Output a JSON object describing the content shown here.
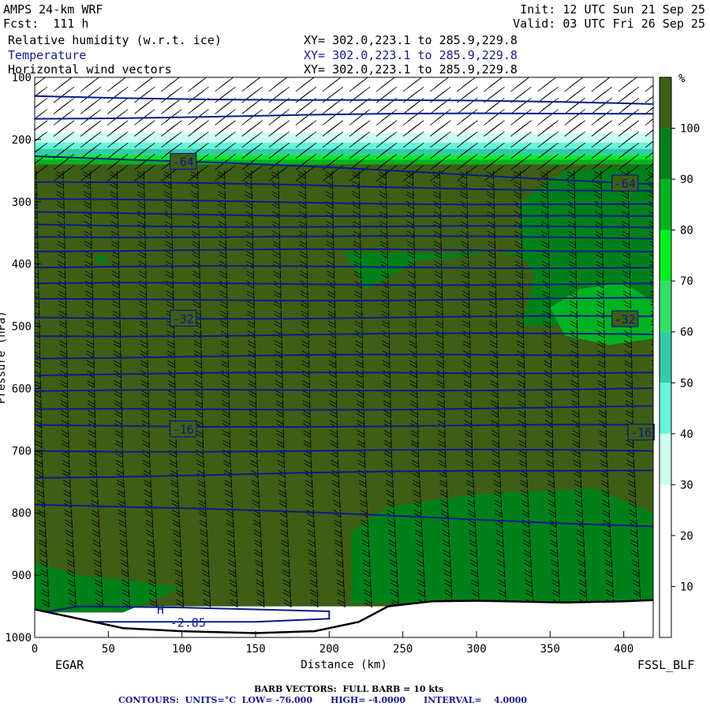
{
  "header": {
    "model": "AMPS 24-km WRF",
    "fcst": "Fcst:  111 h",
    "init": "Init: 12 UTC Sun 21 Sep 25",
    "valid": "Valid: 03 UTC Fri 26 Sep 25",
    "fields": [
      {
        "name": "Relative humidity (w.r.t. ice)",
        "xy": "XY= 302.0,223.1 to 285.9,229.8",
        "color": "#000000"
      },
      {
        "name": "Temperature",
        "xy": "XY= 302.0,223.1 to 285.9,229.8",
        "color": "#1a1a8c"
      },
      {
        "name": "Horizontal wind vectors",
        "xy": "XY= 302.0,223.1 to 285.9,229.8",
        "color": "#000000"
      }
    ]
  },
  "footer": {
    "left_label": "EGAR",
    "right_label": "FSSL_BLF",
    "barb_note": "BARB VECTORS:  FULL BARB = 10 kts",
    "contours": "CONTOURS:  UNITS=°C  LOW= -76.000      HIGH= -4.0000      INTERVAL=    4.0000"
  },
  "chart_data": {
    "type": "heatmap",
    "title": "Relative humidity (w.r.t. ice) / Temperature / Horizontal wind vectors",
    "xlabel": "Distance (km)",
    "ylabel": "Pressure (hPa)",
    "xlim": [
      0,
      420
    ],
    "ylim": [
      1000,
      100
    ],
    "xticks": [
      0,
      50,
      100,
      150,
      200,
      250,
      300,
      350,
      400
    ],
    "yticks": [
      100,
      200,
      300,
      400,
      500,
      600,
      700,
      800,
      900,
      1000
    ],
    "colorbar": {
      "unit": "%",
      "ticks": [
        10,
        20,
        30,
        40,
        50,
        60,
        70,
        80,
        90,
        100
      ],
      "bins": [
        {
          "from": 0,
          "to": 10,
          "color": "#ffffff"
        },
        {
          "from": 10,
          "to": 20,
          "color": "#ffffff"
        },
        {
          "from": 20,
          "to": 30,
          "color": "#ffffff"
        },
        {
          "from": 30,
          "to": 40,
          "color": "#ccfff0"
        },
        {
          "from": 40,
          "to": 50,
          "color": "#66f5d9"
        },
        {
          "from": 50,
          "to": 60,
          "color": "#33ccaa"
        },
        {
          "from": 60,
          "to": 70,
          "color": "#33e066"
        },
        {
          "from": 70,
          "to": 80,
          "color": "#00ee22"
        },
        {
          "from": 80,
          "to": 90,
          "color": "#00b320"
        },
        {
          "from": 90,
          "to": 100,
          "color": "#00801a"
        },
        {
          "from": 100,
          "to": 110,
          "color": "#3d5e14"
        }
      ]
    },
    "rh_regions": [
      {
        "rh": 100,
        "poly": [
          [
            0,
            240
          ],
          [
            420,
            240
          ],
          [
            420,
            950
          ],
          [
            0,
            950
          ]
        ]
      },
      {
        "rh": 95,
        "poly": [
          [
            210,
            380
          ],
          [
            330,
            385
          ],
          [
            340,
            420
          ],
          [
            330,
            500
          ],
          [
            420,
            495
          ],
          [
            420,
            240
          ],
          [
            360,
            250
          ],
          [
            330,
            300
          ],
          [
            330,
            380
          ],
          [
            260,
            395
          ],
          [
            225,
            440
          ]
        ]
      },
      {
        "rh": 95,
        "poly": [
          [
            215,
            830
          ],
          [
            240,
            790
          ],
          [
            300,
            770
          ],
          [
            380,
            760
          ],
          [
            420,
            800
          ],
          [
            420,
            945
          ],
          [
            215,
            945
          ]
        ]
      },
      {
        "rh": 95,
        "poly": [
          [
            0,
            880
          ],
          [
            30,
            900
          ],
          [
            70,
            910
          ],
          [
            100,
            920
          ],
          [
            60,
            960
          ],
          [
            0,
            960
          ]
        ]
      },
      {
        "rh": 85,
        "poly": [
          [
            350,
            470
          ],
          [
            370,
            440
          ],
          [
            400,
            430
          ],
          [
            420,
            460
          ],
          [
            420,
            520
          ],
          [
            390,
            530
          ],
          [
            360,
            515
          ]
        ]
      },
      {
        "rh": 95,
        "poly": [
          [
            40,
            390
          ],
          [
            45,
            385
          ],
          [
            50,
            395
          ],
          [
            45,
            400
          ]
        ]
      }
    ],
    "rh_top_bands": [
      {
        "p_top": 100,
        "p_bot": 190,
        "rh": 0
      },
      {
        "p_top": 190,
        "p_bot": 205,
        "rh": 35
      },
      {
        "p_top": 205,
        "p_bot": 215,
        "rh": 45
      },
      {
        "p_top": 215,
        "p_bot": 225,
        "rh": 55
      },
      {
        "p_top": 225,
        "p_bot": 232,
        "rh": 75
      },
      {
        "p_top": 232,
        "p_bot": 240,
        "rh": 85
      },
      {
        "p_top": 240,
        "p_bot": 250,
        "rh": 95
      }
    ],
    "terrain": [
      [
        0,
        955
      ],
      [
        20,
        965
      ],
      [
        60,
        985
      ],
      [
        100,
        990
      ],
      [
        150,
        993
      ],
      [
        190,
        990
      ],
      [
        220,
        975
      ],
      [
        240,
        950
      ],
      [
        270,
        942
      ],
      [
        300,
        941
      ],
      [
        340,
        943
      ],
      [
        360,
        944
      ],
      [
        400,
        942
      ],
      [
        420,
        940
      ]
    ],
    "isotherms": [
      {
        "p_left": 130,
        "p_right": 143
      },
      {
        "p_left": 165,
        "p_right": 157
      },
      {
        "p_left": 225,
        "p_right": 270,
        "label": "-64",
        "label_x": 92,
        "label_p": 235
      },
      {
        "p_left": 268,
        "p_right": 282
      },
      {
        "p_left": 297,
        "p_right": 305
      },
      {
        "p_left": 318,
        "p_right": 325
      },
      {
        "p_left": 337,
        "p_right": 342
      },
      {
        "p_left": 355,
        "p_right": 358
      },
      {
        "p_left": 378,
        "p_right": 378
      },
      {
        "p_left": 405,
        "p_right": 405
      },
      {
        "p_left": 432,
        "p_right": 432
      },
      {
        "p_left": 458,
        "p_right": 456
      },
      {
        "p_left": 487,
        "p_right": 485,
        "label": "-32",
        "label_x": 92,
        "label_p": 487
      },
      {
        "p_left": 515,
        "p_right": 512
      },
      {
        "p_left": 550,
        "p_right": 545
      },
      {
        "p_left": 578,
        "p_right": 573
      },
      {
        "p_left": 605,
        "p_right": 600
      },
      {
        "p_left": 635,
        "p_right": 630
      },
      {
        "p_left": 660,
        "p_right": 660,
        "label": "-16",
        "label_x": 92,
        "label_p": 665
      },
      {
        "p_left": 700,
        "p_right": 700
      },
      {
        "p_left": 742,
        "p_right": 730
      },
      {
        "p_left": 785,
        "p_right": 820
      }
    ],
    "isotherm_labels_right": [
      {
        "label": "-64",
        "x": 392,
        "p": 270
      },
      {
        "label": "-32",
        "x": 392,
        "p": 488
      },
      {
        "label": "-16",
        "x": 403,
        "p": 670
      }
    ],
    "closed_contours": [
      {
        "poly": [
          [
            5,
            960
          ],
          [
            30,
            950
          ],
          [
            100,
            952
          ],
          [
            150,
            955
          ],
          [
            200,
            958
          ],
          [
            200,
            970
          ],
          [
            150,
            975
          ],
          [
            100,
            975
          ],
          [
            40,
            975
          ],
          [
            10,
            970
          ]
        ]
      },
      {
        "poly": [
          [
            245,
            950
          ],
          [
            280,
            942
          ],
          [
            320,
            945
          ],
          [
            360,
            948
          ],
          [
            345,
            952
          ],
          [
            300,
            950
          ],
          [
            260,
            955
          ]
        ]
      }
    ],
    "annotations": [
      {
        "text": "H",
        "x": 83,
        "p": 962
      },
      {
        "text": "-2.85",
        "x": 92,
        "p": 983
      }
    ]
  }
}
